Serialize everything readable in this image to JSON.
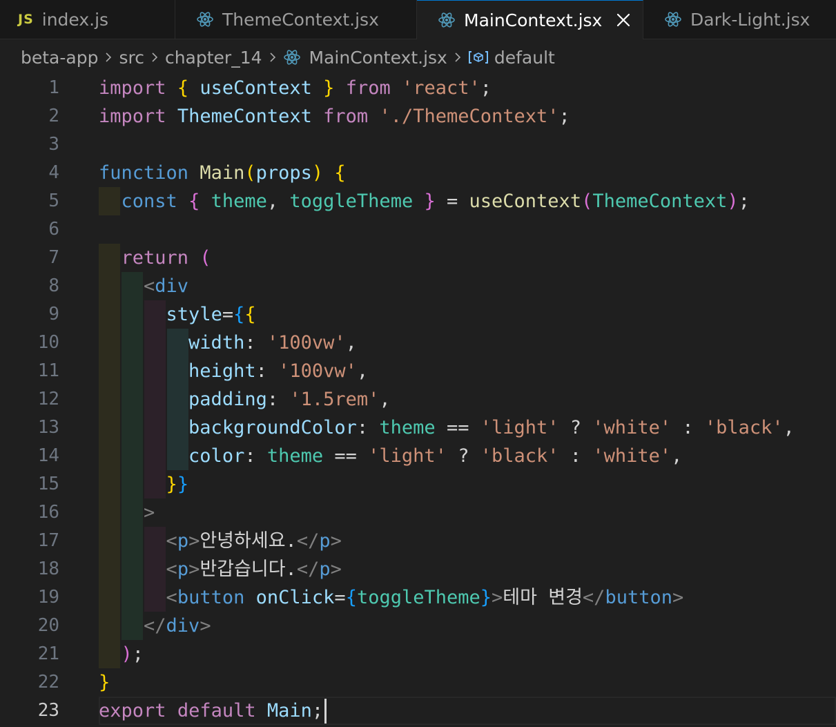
{
  "tabs": [
    {
      "label": "index.js",
      "icon": "js-icon",
      "active": false
    },
    {
      "label": "ThemeContext.jsx",
      "icon": "react-icon",
      "active": false
    },
    {
      "label": "MainContext.jsx",
      "icon": "react-icon",
      "active": true
    },
    {
      "label": "Dark-Light.jsx",
      "icon": "react-icon",
      "active": false
    }
  ],
  "breadcrumb": {
    "parts": [
      "beta-app",
      "src",
      "chapter_14"
    ],
    "file": "MainContext.jsx",
    "symbol": "default"
  },
  "editor": {
    "current_line": 23,
    "lines": [
      [
        [
          "k",
          "import"
        ],
        [
          "p",
          " "
        ],
        [
          "b1",
          "{"
        ],
        [
          "p",
          " "
        ],
        [
          "v",
          "useContext"
        ],
        [
          "p",
          " "
        ],
        [
          "b1",
          "}"
        ],
        [
          "p",
          " "
        ],
        [
          "k",
          "from"
        ],
        [
          "p",
          " "
        ],
        [
          "s",
          "'react'"
        ],
        [
          "p",
          ";"
        ]
      ],
      [
        [
          "k",
          "import"
        ],
        [
          "p",
          " "
        ],
        [
          "v",
          "ThemeContext"
        ],
        [
          "p",
          " "
        ],
        [
          "k",
          "from"
        ],
        [
          "p",
          " "
        ],
        [
          "s",
          "'./ThemeContext'"
        ],
        [
          "p",
          ";"
        ]
      ],
      [],
      [
        [
          "kb",
          "function"
        ],
        [
          "p",
          " "
        ],
        [
          "f",
          "Main"
        ],
        [
          "b1",
          "("
        ],
        [
          "v",
          "props"
        ],
        [
          "b1",
          ")"
        ],
        [
          "p",
          " "
        ],
        [
          "b1",
          "{"
        ]
      ],
      [
        [
          "p",
          "  "
        ],
        [
          "kb",
          "const"
        ],
        [
          "p",
          " "
        ],
        [
          "b2",
          "{"
        ],
        [
          "p",
          " "
        ],
        [
          "c",
          "theme"
        ],
        [
          "p",
          ", "
        ],
        [
          "c",
          "toggleTheme"
        ],
        [
          "p",
          " "
        ],
        [
          "b2",
          "}"
        ],
        [
          "p",
          " = "
        ],
        [
          "f",
          "useContext"
        ],
        [
          "b2",
          "("
        ],
        [
          "c",
          "ThemeContext"
        ],
        [
          "b2",
          ")"
        ],
        [
          "p",
          ";"
        ]
      ],
      [],
      [
        [
          "p",
          "  "
        ],
        [
          "k",
          "return"
        ],
        [
          "p",
          " "
        ],
        [
          "b2",
          "("
        ]
      ],
      [
        [
          "p",
          "    "
        ],
        [
          "t",
          "<"
        ],
        [
          "tg",
          "div"
        ]
      ],
      [
        [
          "p",
          "      "
        ],
        [
          "v",
          "style"
        ],
        [
          "p",
          "="
        ],
        [
          "b3",
          "{"
        ],
        [
          "b1",
          "{"
        ]
      ],
      [
        [
          "p",
          "        "
        ],
        [
          "v",
          "width"
        ],
        [
          "p",
          ": "
        ],
        [
          "s",
          "'100vw'"
        ],
        [
          "p",
          ","
        ]
      ],
      [
        [
          "p",
          "        "
        ],
        [
          "v",
          "height"
        ],
        [
          "p",
          ": "
        ],
        [
          "s",
          "'100vw'"
        ],
        [
          "p",
          ","
        ]
      ],
      [
        [
          "p",
          "        "
        ],
        [
          "v",
          "padding"
        ],
        [
          "p",
          ": "
        ],
        [
          "s",
          "'1.5rem'"
        ],
        [
          "p",
          ","
        ]
      ],
      [
        [
          "p",
          "        "
        ],
        [
          "v",
          "backgroundColor"
        ],
        [
          "p",
          ": "
        ],
        [
          "c",
          "theme"
        ],
        [
          "p",
          " == "
        ],
        [
          "s",
          "'light'"
        ],
        [
          "p",
          " ? "
        ],
        [
          "s",
          "'white'"
        ],
        [
          "p",
          " : "
        ],
        [
          "s",
          "'black'"
        ],
        [
          "p",
          ","
        ]
      ],
      [
        [
          "p",
          "        "
        ],
        [
          "v",
          "color"
        ],
        [
          "p",
          ": "
        ],
        [
          "c",
          "theme"
        ],
        [
          "p",
          " == "
        ],
        [
          "s",
          "'light'"
        ],
        [
          "p",
          " ? "
        ],
        [
          "s",
          "'black'"
        ],
        [
          "p",
          " : "
        ],
        [
          "s",
          "'white'"
        ],
        [
          "p",
          ","
        ]
      ],
      [
        [
          "p",
          "      "
        ],
        [
          "b1",
          "}"
        ],
        [
          "b3",
          "}"
        ]
      ],
      [
        [
          "p",
          "    "
        ],
        [
          "t",
          ">"
        ]
      ],
      [
        [
          "p",
          "      "
        ],
        [
          "t",
          "<"
        ],
        [
          "tg",
          "p"
        ],
        [
          "t",
          ">"
        ],
        [
          "p",
          "안녕하세요."
        ],
        [
          "t",
          "</"
        ],
        [
          "tg",
          "p"
        ],
        [
          "t",
          ">"
        ]
      ],
      [
        [
          "p",
          "      "
        ],
        [
          "t",
          "<"
        ],
        [
          "tg",
          "p"
        ],
        [
          "t",
          ">"
        ],
        [
          "p",
          "반갑습니다."
        ],
        [
          "t",
          "</"
        ],
        [
          "tg",
          "p"
        ],
        [
          "t",
          ">"
        ]
      ],
      [
        [
          "p",
          "      "
        ],
        [
          "t",
          "<"
        ],
        [
          "tg",
          "button"
        ],
        [
          "p",
          " "
        ],
        [
          "v",
          "onClick"
        ],
        [
          "p",
          "="
        ],
        [
          "b3",
          "{"
        ],
        [
          "c",
          "toggleTheme"
        ],
        [
          "b3",
          "}"
        ],
        [
          "t",
          ">"
        ],
        [
          "p",
          "테마 변경"
        ],
        [
          "t",
          "</"
        ],
        [
          "tg",
          "button"
        ],
        [
          "t",
          ">"
        ]
      ],
      [
        [
          "p",
          "    "
        ],
        [
          "t",
          "</"
        ],
        [
          "tg",
          "div"
        ],
        [
          "t",
          ">"
        ]
      ],
      [
        [
          "p",
          "  "
        ],
        [
          "b2",
          ")"
        ],
        [
          "p",
          ";"
        ]
      ],
      [
        [
          "b1",
          "}"
        ]
      ],
      [
        [
          "k",
          "export"
        ],
        [
          "p",
          " "
        ],
        [
          "k",
          "default"
        ],
        [
          "p",
          " "
        ],
        [
          "v",
          "Main"
        ],
        [
          "p",
          ";"
        ]
      ]
    ]
  }
}
